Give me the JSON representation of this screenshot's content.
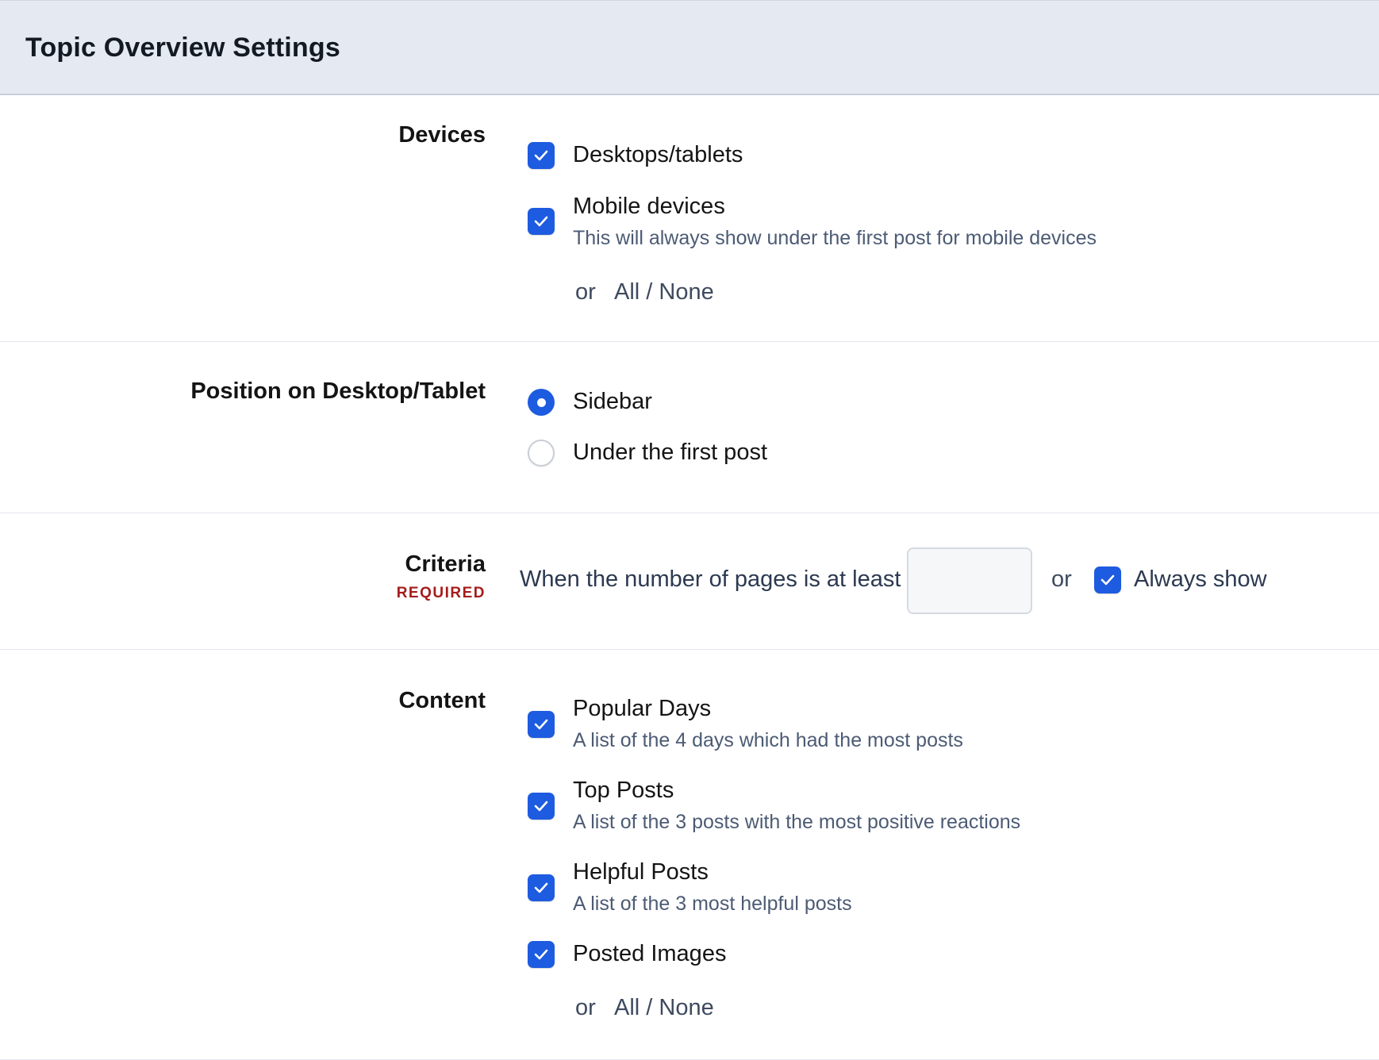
{
  "header": {
    "title": "Topic Overview Settings"
  },
  "devices": {
    "label": "Devices",
    "options": [
      {
        "label": "Desktops/tablets",
        "checked": true
      },
      {
        "label": "Mobile devices",
        "description": "This will always show under the first post for mobile devices",
        "checked": true
      }
    ],
    "or": "or",
    "all_none": "All / None"
  },
  "position": {
    "label": "Position on Desktop/Tablet",
    "options": [
      {
        "label": "Sidebar",
        "selected": true
      },
      {
        "label": "Under the first post",
        "selected": false
      }
    ]
  },
  "criteria": {
    "label": "Criteria",
    "required": "REQUIRED",
    "prefix": "When the number of pages is at least",
    "input_value": "",
    "or": "or",
    "always_show": {
      "label": "Always show",
      "checked": true
    }
  },
  "content": {
    "label": "Content",
    "options": [
      {
        "label": "Popular Days",
        "description": "A list of the 4 days which had the most posts",
        "checked": true
      },
      {
        "label": "Top Posts",
        "description": "A list of the 3 posts with the most positive reactions",
        "checked": true
      },
      {
        "label": "Helpful Posts",
        "description": "A list of the 3 most helpful posts",
        "checked": true
      },
      {
        "label": "Posted Images",
        "checked": true
      }
    ],
    "or": "or",
    "all_none": "All / None"
  },
  "colors": {
    "header_bg": "#e4e9f2",
    "accent": "#1d5be0",
    "required": "#a61c1c",
    "description": "#4c5b74"
  }
}
